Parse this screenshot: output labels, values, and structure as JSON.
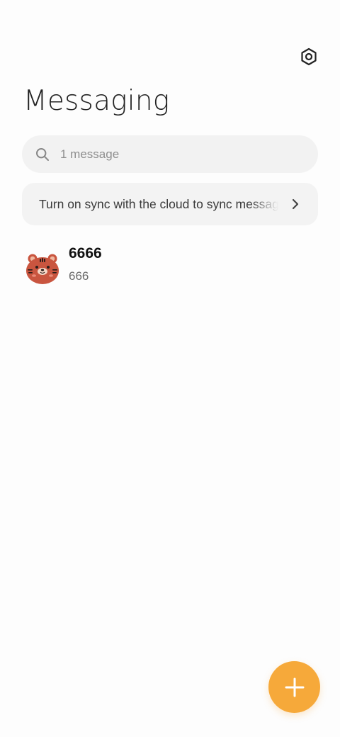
{
  "header": {
    "title": "Messaging",
    "settings_icon": "settings-hexagon-icon"
  },
  "search": {
    "placeholder": "1 message",
    "value": "",
    "icon": "search-icon"
  },
  "sync_banner": {
    "text": "Turn on sync with the cloud to sync messages",
    "icon": "chevron-right-icon"
  },
  "conversations": [
    {
      "name": "6666",
      "preview": "666",
      "avatar": "tiger-avatar"
    }
  ],
  "fab": {
    "icon": "plus-icon",
    "color": "#F6A93A"
  },
  "colors": {
    "accent": "#F6A93A",
    "avatar": "#C9553F",
    "surface": "#F2F2F2"
  }
}
